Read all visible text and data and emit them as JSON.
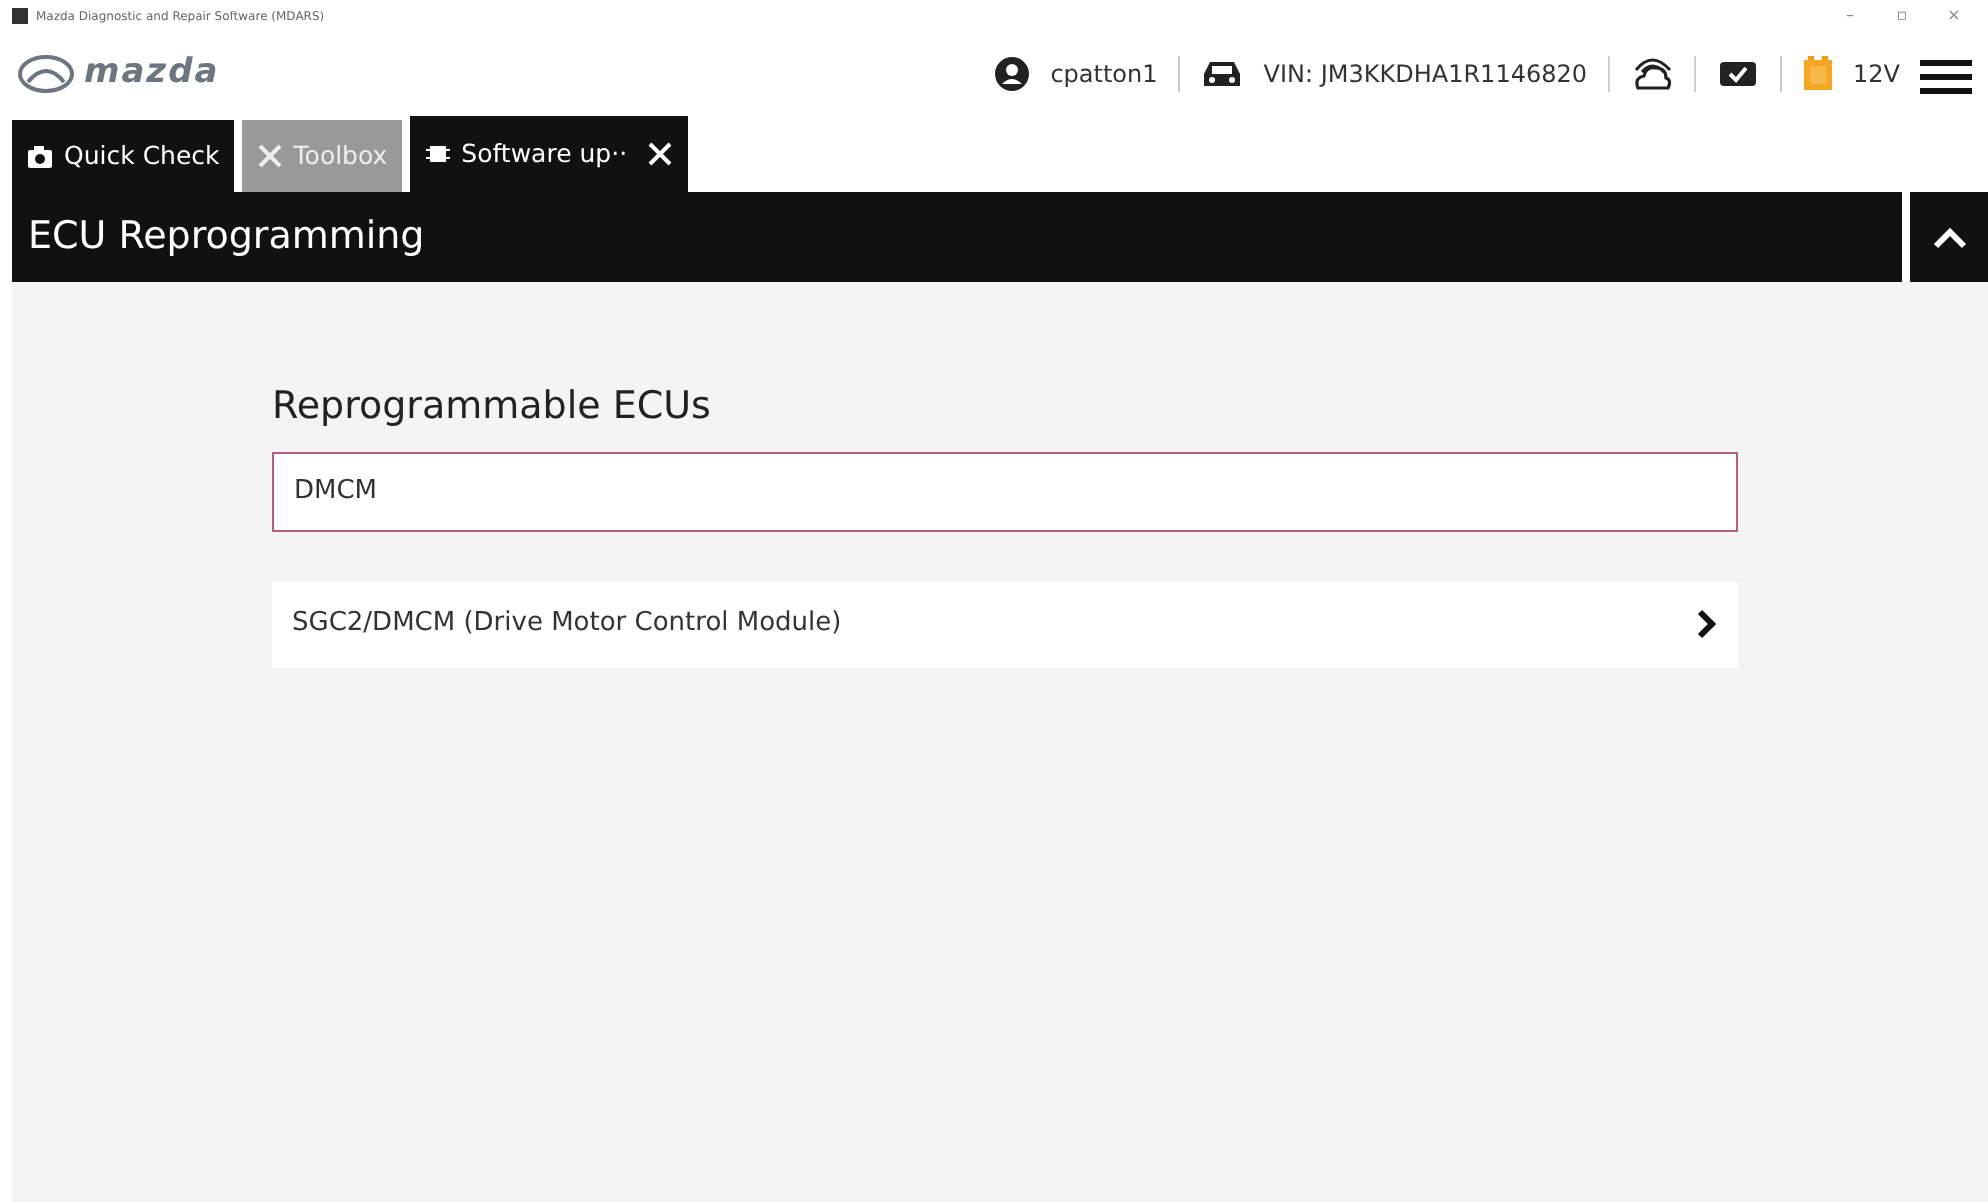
{
  "window": {
    "title": "Mazda Diagnostic and Repair Software (MDARS)",
    "controls": [
      "–",
      "▫",
      "×"
    ]
  },
  "header": {
    "logo": "mazda",
    "user": "cpatton1",
    "vin": "VIN: JM3KKDHA1R1146820",
    "voltage": "12V"
  },
  "tabs": [
    {
      "label": "Quick Check",
      "selected": false,
      "disabled": false,
      "closable": false
    },
    {
      "label": "Toolbox",
      "selected": false,
      "disabled": true,
      "closable": false
    },
    {
      "label": "Software up··",
      "selected": true,
      "disabled": false,
      "closable": true
    }
  ],
  "section": {
    "title": "ECU Reprogramming",
    "expanded": true
  },
  "content": {
    "heading": "Reprogrammable ECUs",
    "search": {
      "value": "DMCM"
    },
    "items": [
      {
        "label": "SGC2/DMCM (Drive Motor Control Module)"
      }
    ]
  }
}
